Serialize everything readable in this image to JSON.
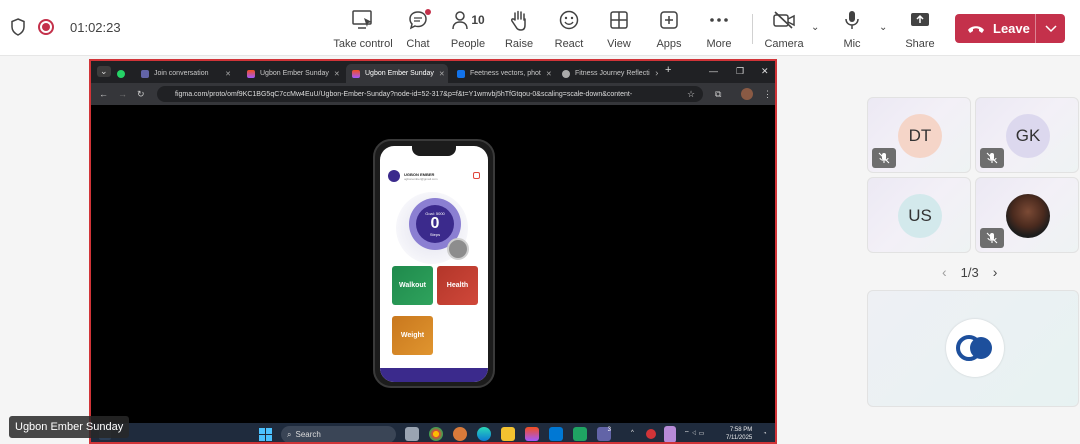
{
  "meeting": {
    "timer": "01:02:23",
    "controls": [
      {
        "label": "Take control",
        "icon": "take-control-icon"
      },
      {
        "label": "Chat",
        "icon": "chat-icon"
      },
      {
        "label": "People",
        "icon": "people-icon",
        "count": "10"
      },
      {
        "label": "Raise",
        "icon": "raise-hand-icon"
      },
      {
        "label": "React",
        "icon": "react-icon"
      },
      {
        "label": "View",
        "icon": "view-icon"
      },
      {
        "label": "Apps",
        "icon": "apps-icon"
      },
      {
        "label": "More",
        "icon": "more-icon"
      },
      {
        "label": "Camera",
        "icon": "camera-off-icon"
      },
      {
        "label": "Mic",
        "icon": "mic-icon"
      },
      {
        "label": "Share",
        "icon": "share-icon"
      }
    ],
    "leave_label": "Leave",
    "accent": "#c4314b"
  },
  "browser": {
    "tabs": [
      {
        "label": "",
        "icon": "whatsapp-icon"
      },
      {
        "label": "Join conversation",
        "icon": "teams-icon"
      },
      {
        "label": "Ugbon Ember Sunday",
        "icon": "figma-icon"
      },
      {
        "label": "Ugbon Ember Sunday",
        "icon": "figma-icon"
      },
      {
        "label": "Feetness vectors, phot",
        "icon": "freepik-icon"
      },
      {
        "label": "Fitness Journey Reflecti",
        "icon": "web-icon"
      }
    ],
    "url": "figma.com/proto/omf9KC1BG5qC7ccMw4EuU/Ugbon-Ember-Sunday?node-id=52-317&p=f&t=Y1wmvbj5hTfGtqou-0&scaling=scale-down&content-"
  },
  "app": {
    "user_name": "UGBON EMBER",
    "user_sub": "ugbonember@gmail.com",
    "goal": "Goal: 5000",
    "steps_value": "0",
    "steps_label": "Steps",
    "cards": [
      "Walkout",
      "Health",
      "Weight"
    ]
  },
  "taskbar": {
    "search_label": "Search",
    "time": "7:58 PM",
    "date": "7/11/2025",
    "badge": "3"
  },
  "participants": [
    {
      "initials": "DT",
      "color": "#f5d5c8",
      "muted": true
    },
    {
      "initials": "GK",
      "color": "#dcd8ee",
      "muted": true
    },
    {
      "initials": "US",
      "color": "#d3e9ec",
      "muted": false
    },
    {
      "initials": "",
      "photo": true,
      "muted": true
    }
  ],
  "pager": "1/3",
  "caption": "Ugbon Ember Sunday"
}
